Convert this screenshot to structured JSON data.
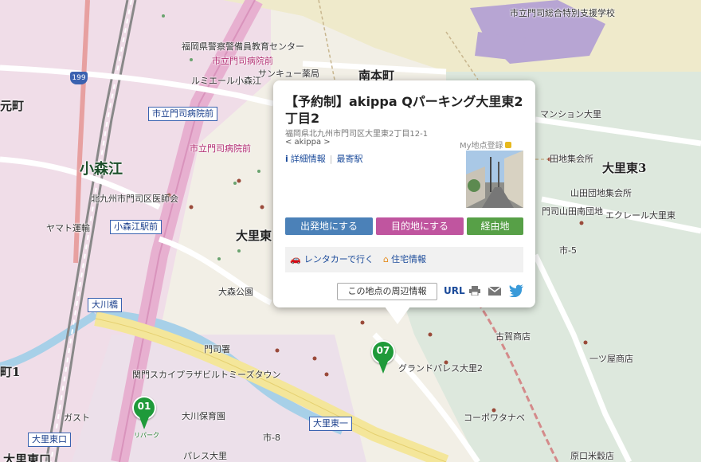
{
  "map": {
    "labels": {
      "school": "市立門司総合特別支援学校",
      "police_center": "福岡県警察警備員教育センター",
      "hospital_mae_top": "市立門司病院前",
      "sankyu": "サンキュー薬局",
      "lumiere": "ルミエール小森江",
      "minamihonmachi": "南本町",
      "motomachi": "元町",
      "busstop_hospital": "市立門司病院前",
      "hospital_mae_mid": "市立門司病院前",
      "station": "小森江",
      "ishikai": "北九州市門司区医師会",
      "yamato": "ヤマト運輸",
      "busstop_komorie": "小森江駅前",
      "ozatohigashi_mid": "大里東",
      "omori_park": "大森公園",
      "busstop_okawabashi": "大川橋",
      "mojisho": "門司署",
      "skyplaza": "関門スカイプラザビルトミーズタウン",
      "ozatohigashi_south": "大里東一",
      "okawa_hoikuen": "大川保育園",
      "gusto": "ガスト",
      "busstop_ozatohigashiguchi": "大里東口",
      "ozatohigashiguchi_bottom": "大里東口",
      "palace": "パレス大里",
      "ri8": "市-8",
      "ri5": "市-5",
      "machi1": "町1",
      "mansion": "マンション大里",
      "yamada_hall": "田地集会所",
      "ozatohigashi3": "大里東3",
      "yamada_danchi_hall": "山田団地集会所",
      "yamada_minamidan": "門司山田南団地",
      "ecrail": "エクレール大里東",
      "koga": "古賀商店",
      "hitotsuya": "一ツ屋商店",
      "grand_palace": "グランドパレス大里2",
      "corpo": "コーポワタナベ",
      "haraguchi": "原口米穀店"
    },
    "route_shield": "199",
    "markers": [
      {
        "num": "01",
        "color": "#1f9a3a",
        "sub": "リパーク"
      },
      {
        "num": "07",
        "color": "#1f9a3a"
      }
    ]
  },
  "popup": {
    "title": "【予約制】akippa Qパーキング大里東2丁目2",
    "address": "福岡県北九州市門司区大里東2丁目12-1",
    "provider": "< akippa >",
    "my_save": "My地点登録",
    "link_detail": "詳細情報",
    "link_station": "最寄駅",
    "btn_departure": "出発地にする",
    "btn_destination": "目的地にする",
    "btn_via": "経由地",
    "rent_car": "レンタカーで行く",
    "housing": "住宅情報",
    "nearby": "この地点の周辺情報",
    "url_label": "URL",
    "colors": {
      "departure": "#4b81b8",
      "destination": "#c0559f",
      "via": "#57a047"
    }
  }
}
